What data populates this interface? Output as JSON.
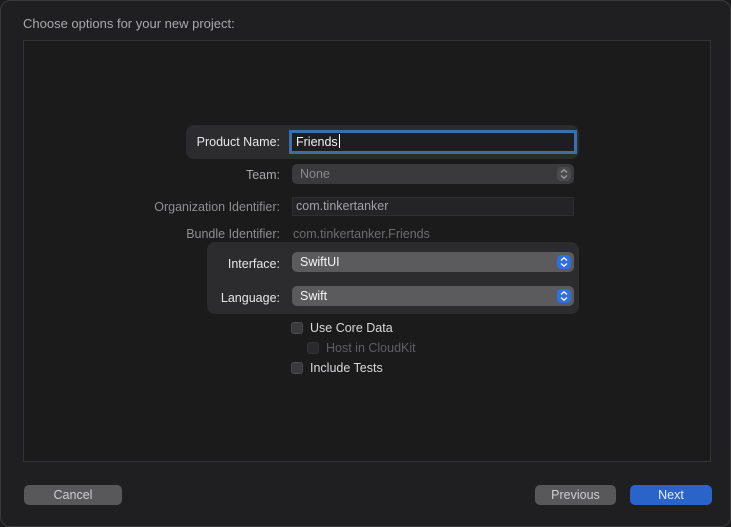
{
  "dialog": {
    "heading": "Choose options for your new project:"
  },
  "form": {
    "product_name": {
      "label": "Product Name:",
      "value": "Friends"
    },
    "team": {
      "label": "Team:",
      "value": "None"
    },
    "organization_identifier": {
      "label": "Organization Identifier:",
      "value": "com.tinkertanker"
    },
    "bundle_identifier": {
      "label": "Bundle Identifier:",
      "value": "com.tinkertanker.Friends"
    },
    "interface": {
      "label": "Interface:",
      "value": "SwiftUI"
    },
    "language": {
      "label": "Language:",
      "value": "Swift"
    },
    "checkboxes": {
      "use_core_data": {
        "label": "Use Core Data",
        "checked": false,
        "enabled": true
      },
      "host_in_cloudkit": {
        "label": "Host in CloudKit",
        "checked": false,
        "enabled": false
      },
      "include_tests": {
        "label": "Include Tests",
        "checked": false,
        "enabled": true
      }
    }
  },
  "footer": {
    "cancel": "Cancel",
    "previous": "Previous",
    "next": "Next"
  },
  "colors": {
    "accent": "#2f6fde",
    "focus_ring": "#3a6fae"
  },
  "icons": {
    "popup_stepper": "up-down-chevron-icon"
  }
}
